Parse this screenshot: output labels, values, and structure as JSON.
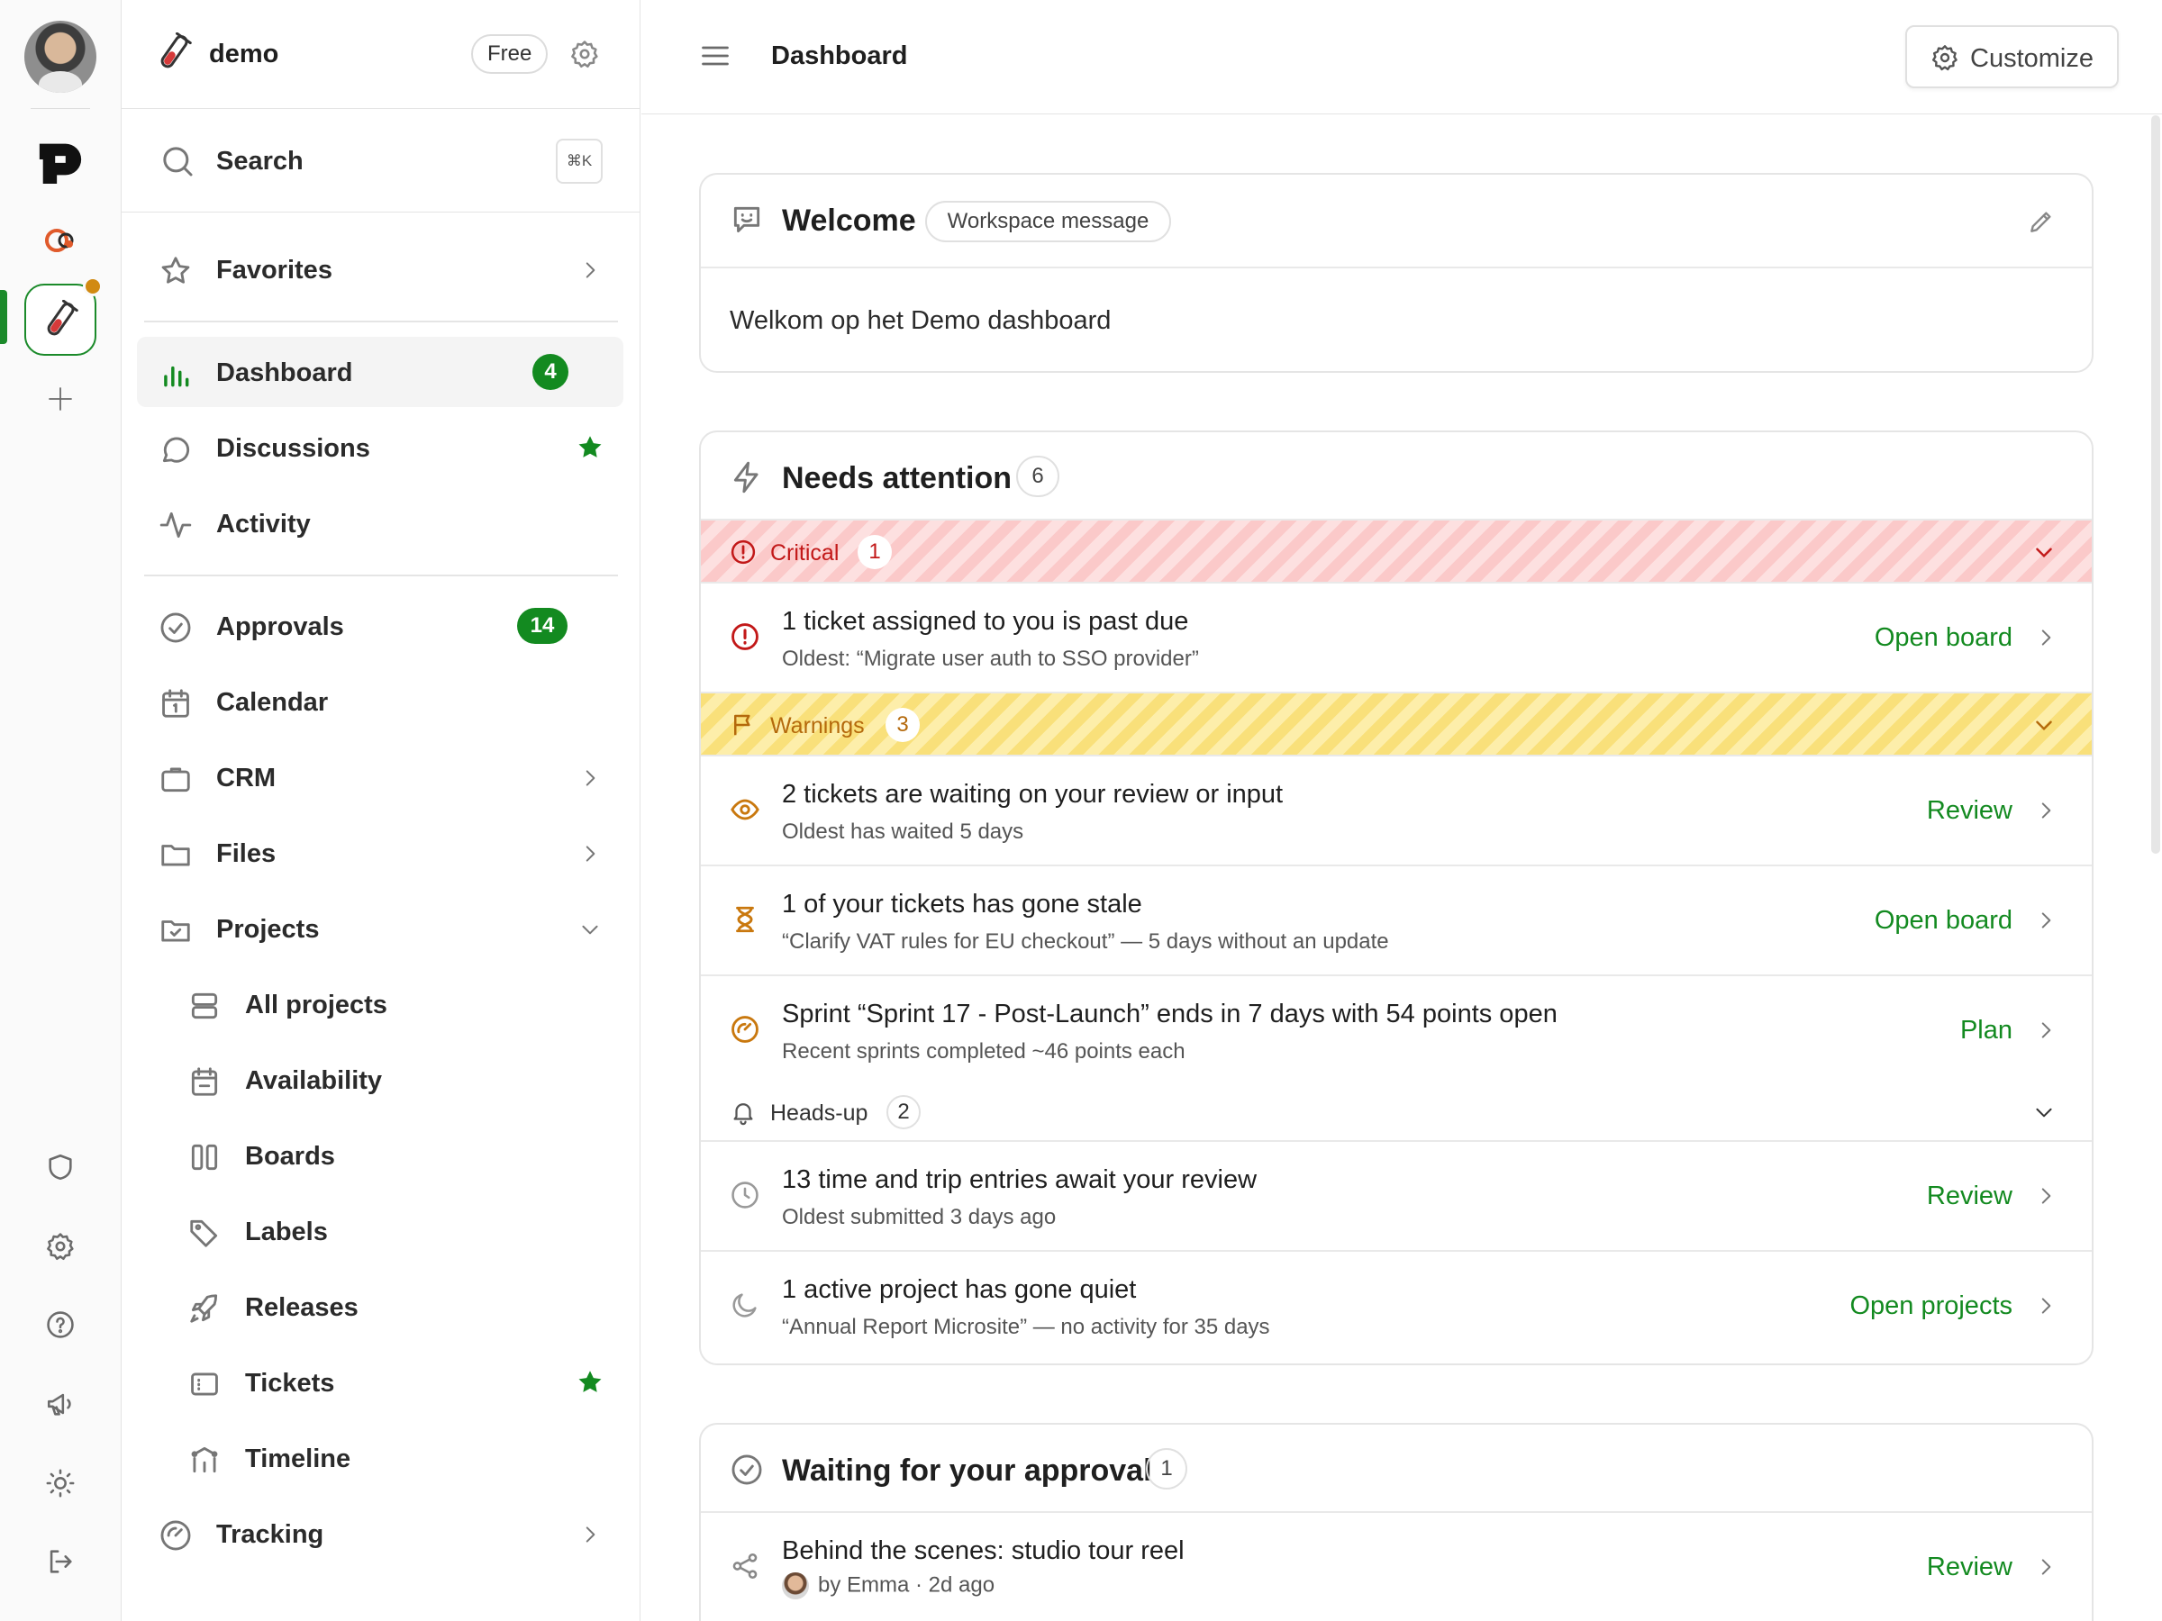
{
  "workspace": {
    "name": "demo",
    "plan": "Free"
  },
  "search": {
    "label": "Search",
    "shortcut": "⌘K"
  },
  "nav": {
    "favorites": "Favorites",
    "dashboard": {
      "label": "Dashboard",
      "count": "4"
    },
    "discussions": "Discussions",
    "activity": "Activity",
    "approvals": {
      "label": "Approvals",
      "count": "14"
    },
    "calendar": "Calendar",
    "crm": "CRM",
    "files": "Files",
    "projects": "Projects",
    "all_projects": "All projects",
    "availability": "Availability",
    "boards": "Boards",
    "labels": "Labels",
    "releases": "Releases",
    "tickets": "Tickets",
    "timeline": "Timeline",
    "tracking": "Tracking"
  },
  "topbar": {
    "title": "Dashboard",
    "customize": "Customize"
  },
  "welcome": {
    "title": "Welcome",
    "badge": "Workspace message",
    "message": "Welkom op het Demo dashboard"
  },
  "attention": {
    "title": "Needs attention",
    "count": "6",
    "critical": {
      "label": "Critical",
      "count": "1"
    },
    "warnings": {
      "label": "Warnings",
      "count": "3"
    },
    "headsup": {
      "label": "Heads-up",
      "count": "2"
    },
    "items": [
      {
        "title": "1 ticket assigned to you is past due",
        "subtitle": "Oldest: “Migrate user auth to SSO provider”",
        "action": "Open board"
      },
      {
        "title": "2 tickets are waiting on your review or input",
        "subtitle": "Oldest has waited 5 days",
        "action": "Review"
      },
      {
        "title": "1 of your tickets has gone stale",
        "subtitle": "“Clarify VAT rules for EU checkout” — 5 days without an update",
        "action": "Open board"
      },
      {
        "title": "Sprint “Sprint 17 - Post-Launch” ends in 7 days with 54 points open",
        "subtitle": "Recent sprints completed ~46 points each",
        "action": "Plan"
      },
      {
        "title": "13 time and trip entries await your review",
        "subtitle": "Oldest submitted 3 days ago",
        "action": "Review"
      },
      {
        "title": "1 active project has gone quiet",
        "subtitle": "“Annual Report Microsite” — no activity for 35 days",
        "action": "Open projects"
      }
    ]
  },
  "approval": {
    "title": "Waiting for your approval",
    "count": "1",
    "item": {
      "title": "Behind the scenes: studio tour reel",
      "byline": "by Emma · 2d ago",
      "action": "Review"
    }
  },
  "colors": {
    "accent": "#138a20",
    "critical": "#c21818",
    "warning": "#c9780e"
  }
}
